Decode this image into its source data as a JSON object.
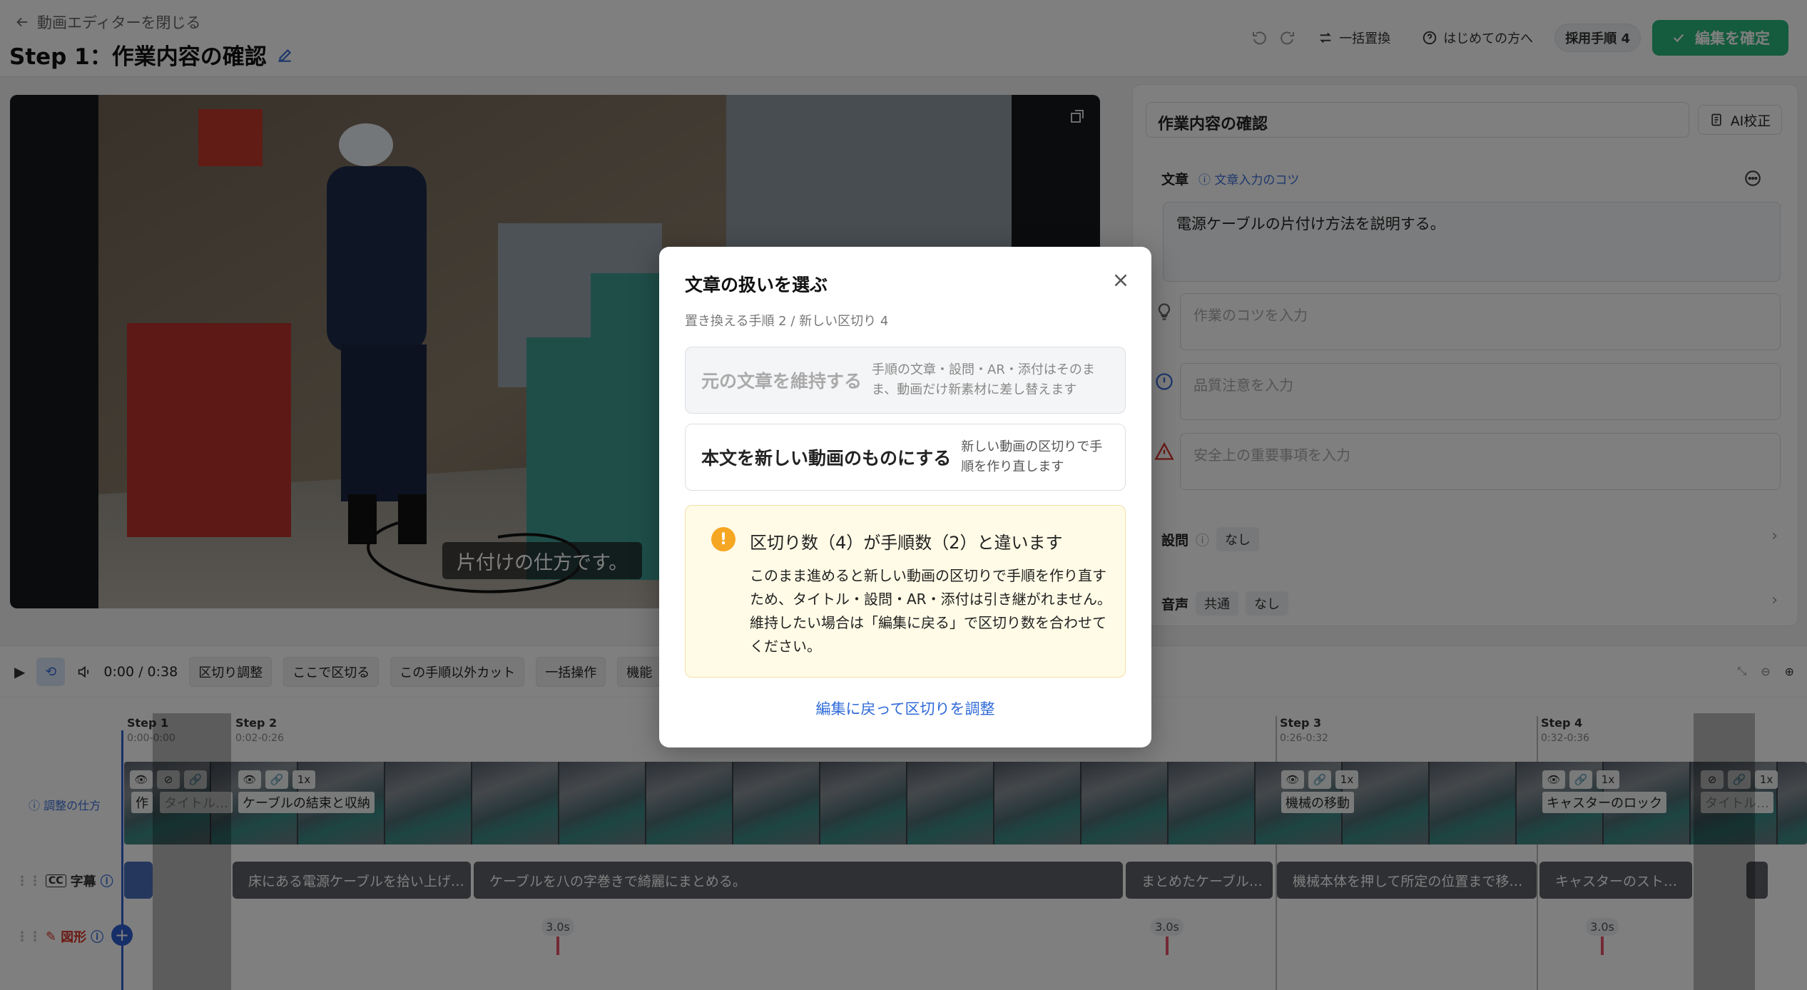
{
  "header": {
    "back_label": "動画エディターを閉じる",
    "title": "Step 1：作業内容の確認",
    "replace_all": "一括置換",
    "first_time": "はじめての方へ",
    "adopted_steps_label": "採用手順",
    "adopted_steps_count": "4",
    "confirm_label": "編集を確定"
  },
  "video": {
    "caption": "片付けの仕方です。"
  },
  "side_panel": {
    "step_title": "作業内容の確認",
    "ai_button": "AI校正",
    "text_label": "文章",
    "text_tip": "文章入力のコツ",
    "main_text": "電源ケーブルの片付け方法を説明する。",
    "tip_placeholder": "作業のコツを入力",
    "quality_placeholder": "品質注意を入力",
    "safety_placeholder": "安全上の重要事項を入力",
    "question_label": "設問",
    "question_value": "なし",
    "audio_label": "音声",
    "audio_common": "共通",
    "audio_value": "なし"
  },
  "controls": {
    "time": "0:00 / 0:38",
    "buttons": [
      "区切り調整",
      "ここで区切る",
      "この手順以外カット",
      "一括操作",
      "機能"
    ]
  },
  "timeline": {
    "howto": "調整の仕方",
    "steps": [
      {
        "label": "Step 1",
        "range": "0:00-0:00"
      },
      {
        "label": "Step 2",
        "range": "0:02-0:26"
      },
      {
        "label": "Step 3",
        "range": "0:26-0:32"
      },
      {
        "label": "Step 4",
        "range": "0:32-0:36"
      }
    ],
    "clip_titles": [
      "作",
      "タイトル…",
      "ケーブルの結束と収納",
      "機械の移動",
      "キャスターのロック",
      "タイトル…"
    ],
    "speed": "1x",
    "subtitle_track": "字幕",
    "shape_track": "図形",
    "subtitles": [
      "床にある電源ケーブルを拾い上げ…",
      "ケーブルを八の字巻きで綺麗にまとめる。",
      "まとめたケーブル…",
      "機械本体を押して所定の位置まで移…",
      "キャスターのスト…"
    ],
    "durations": [
      "3.0s",
      "3.0s",
      "3.0s"
    ]
  },
  "modal": {
    "title": "文章の扱いを選ぶ",
    "subtitle": "置き換える手順 2 / 新しい区切り 4",
    "keep_title": "元の文章を維持する",
    "keep_desc": "手順の文章・設問・AR・添付はそのまま、動画だけ新素材に差し替えます",
    "new_title": "本文を新しい動画のものにする",
    "new_desc": "新しい動画の区切りで手順を作り直します",
    "warn_title": "区切り数（4）が手順数（2）と違います",
    "warn_body": "このまま進めると新しい動画の区切りで手順を作り直すため、タイトル・設問・AR・添付は引き継がれません。維持したい場合は「編集に戻る」で区切り数を合わせてください。",
    "back_link": "編集に戻って区切りを調整"
  }
}
